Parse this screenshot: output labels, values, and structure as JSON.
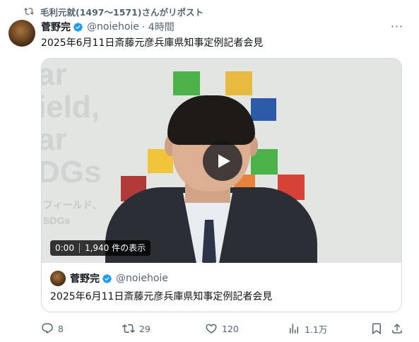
{
  "repost": {
    "text": "毛利元就(1497〜1571)さんがリポスト",
    "icon": "repost-icon"
  },
  "tweet": {
    "name": "菅野完",
    "handle": "@noiehoie",
    "time": "· 4時間",
    "more": "···",
    "text": "2025年6月11日斎藤元彦兵庫県知事定例記者会見",
    "verified_color": "#1d9bf0"
  },
  "video": {
    "background_text": [
      "ar",
      "ield,",
      "ar",
      "DGs"
    ],
    "background_sub": [
      "フィールド、",
      "SDGs"
    ],
    "timestamp": "0:00",
    "views": "1,940 件の表示",
    "play_icon": "play-icon"
  },
  "quote": {
    "name": "菅野完",
    "handle": "@noiehoie",
    "text": "2025年6月11日斎藤元彦兵庫県知事定例記者会見"
  },
  "actions": {
    "reply_count": "8",
    "repost_count": "29",
    "like_count": "120",
    "views_count": "1.1万"
  },
  "colors": {
    "secondary_text": "#536471",
    "border": "#cfd9de"
  }
}
